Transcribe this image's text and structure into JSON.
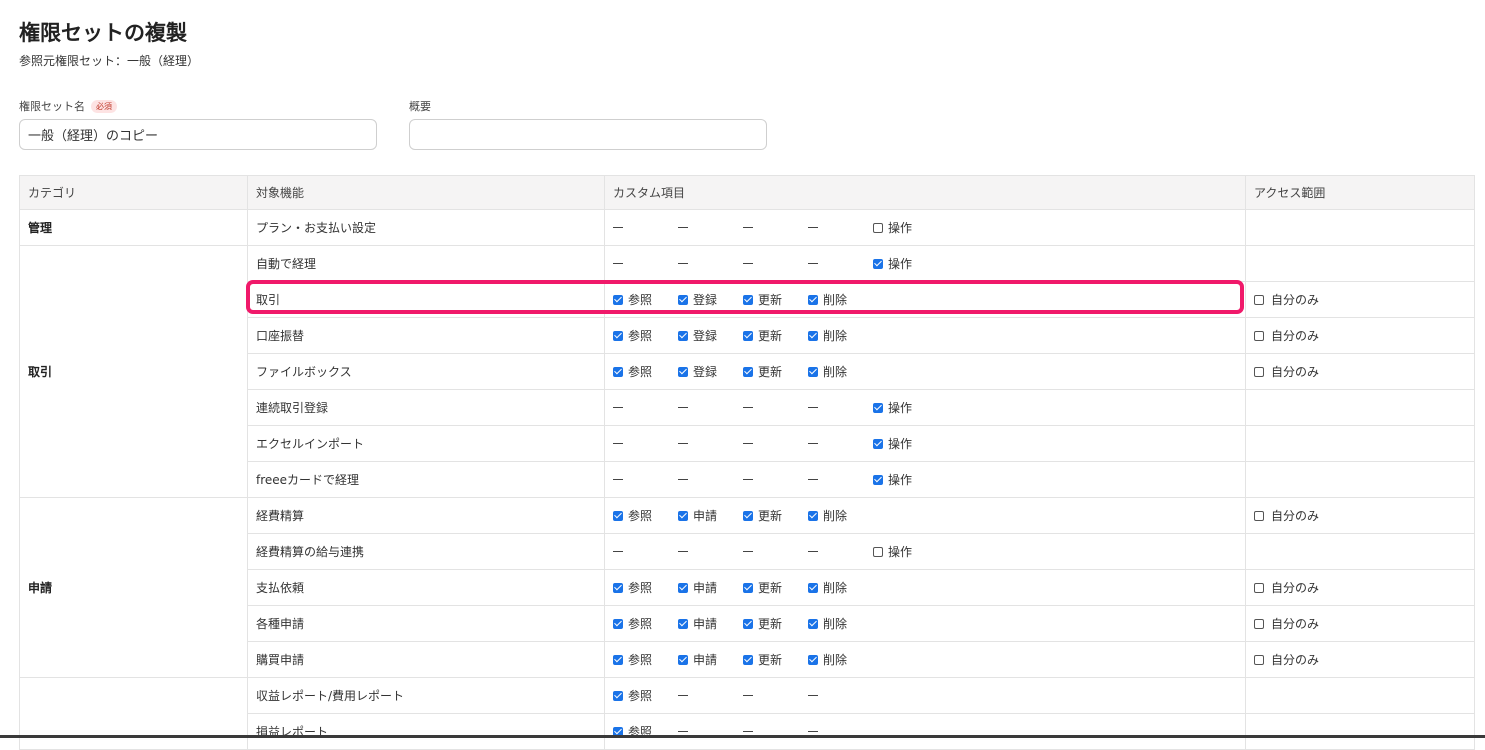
{
  "page": {
    "title": "権限セットの複製",
    "subtitle": "参照元権限セット：一般（経理）"
  },
  "form": {
    "name_label": "権限セット名",
    "required_badge": "必須",
    "name_value": "一般（経理）のコピー",
    "summary_label": "概要",
    "summary_value": ""
  },
  "table": {
    "headers": {
      "category": "カテゴリ",
      "feature": "対象機能",
      "custom": "カスタム項目",
      "access": "アクセス範囲"
    },
    "labels": {
      "dash": "—",
      "op": "操作",
      "view": "参照",
      "register": "登録",
      "update": "更新",
      "delete": "削除",
      "apply": "申請",
      "self_only": "自分のみ"
    },
    "categories": {
      "kanri": "管理",
      "torihiki": "取引",
      "shinsei": "申請"
    },
    "rows": [
      {
        "feature": "プラン・お支払い設定",
        "op_checked": false
      },
      {
        "feature": "自動で経理",
        "op_checked": true
      },
      {
        "feature": "取引",
        "checks": [
          true,
          true,
          true,
          true
        ],
        "self_only": false,
        "highlighted": true
      },
      {
        "feature": "口座振替",
        "checks": [
          true,
          true,
          true,
          true
        ],
        "self_only": false
      },
      {
        "feature": "ファイルボックス",
        "checks": [
          true,
          true,
          true,
          true
        ],
        "self_only": false
      },
      {
        "feature": "連続取引登録",
        "op_checked": true
      },
      {
        "feature": "エクセルインポート",
        "op_checked": true
      },
      {
        "feature": "freeeカードで経理",
        "op_checked": true
      },
      {
        "feature": "経費精算",
        "checks": [
          true,
          true,
          true,
          true
        ],
        "self_only": false
      },
      {
        "feature": "経費精算の給与連携",
        "op_checked": false
      },
      {
        "feature": "支払依頼",
        "checks": [
          true,
          true,
          true,
          true
        ],
        "self_only": false
      },
      {
        "feature": "各種申請",
        "checks": [
          true,
          true,
          true,
          true
        ],
        "self_only": false
      },
      {
        "feature": "購買申請",
        "checks": [
          true,
          true,
          true,
          true
        ],
        "self_only": false
      },
      {
        "feature": "収益レポート/費用レポート",
        "checks": [
          true
        ]
      },
      {
        "feature": "損益レポート",
        "checks": [
          true
        ]
      }
    ]
  },
  "colors": {
    "accent": "#1a73e8",
    "highlight": "#f0196a"
  }
}
